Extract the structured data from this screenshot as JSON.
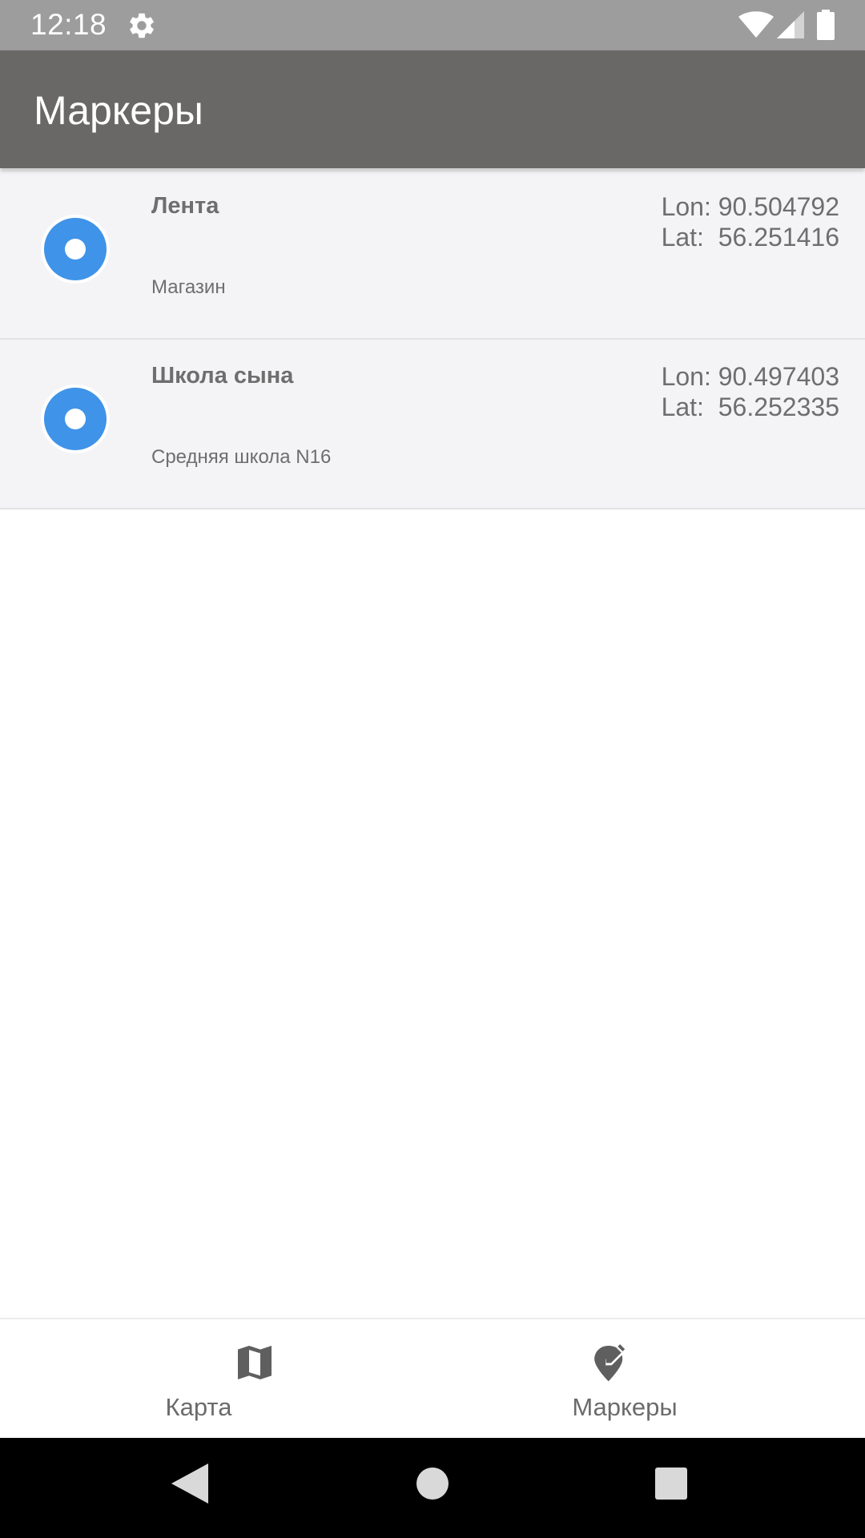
{
  "status_bar": {
    "time": "12:18",
    "icons": [
      "gear-icon",
      "wifi-icon",
      "signal-icon",
      "battery-icon"
    ]
  },
  "app_bar": {
    "title": "Маркеры"
  },
  "markers": [
    {
      "name": "Лента",
      "description": "Магазин",
      "lon_label": "Lon:",
      "lon_value": "90.504792",
      "lat_label": "Lat:",
      "lat_value": "56.251416"
    },
    {
      "name": "Школа сына",
      "description": "Средняя школа N16",
      "lon_label": "Lon:",
      "lon_value": "90.497403",
      "lat_label": "Lat:",
      "lat_value": "56.252335"
    }
  ],
  "bottom_nav": {
    "items": [
      {
        "label": "Карта",
        "icon": "map-icon",
        "active": false
      },
      {
        "label": "Маркеры",
        "icon": "edit-location-icon",
        "active": true
      }
    ]
  },
  "colors": {
    "status_bar": "#9e9d9e",
    "app_bar": "#696866",
    "marker_blue": "#3f93e8",
    "list_background": "#f4f4f7",
    "text_gray": "#6e6e6e"
  }
}
